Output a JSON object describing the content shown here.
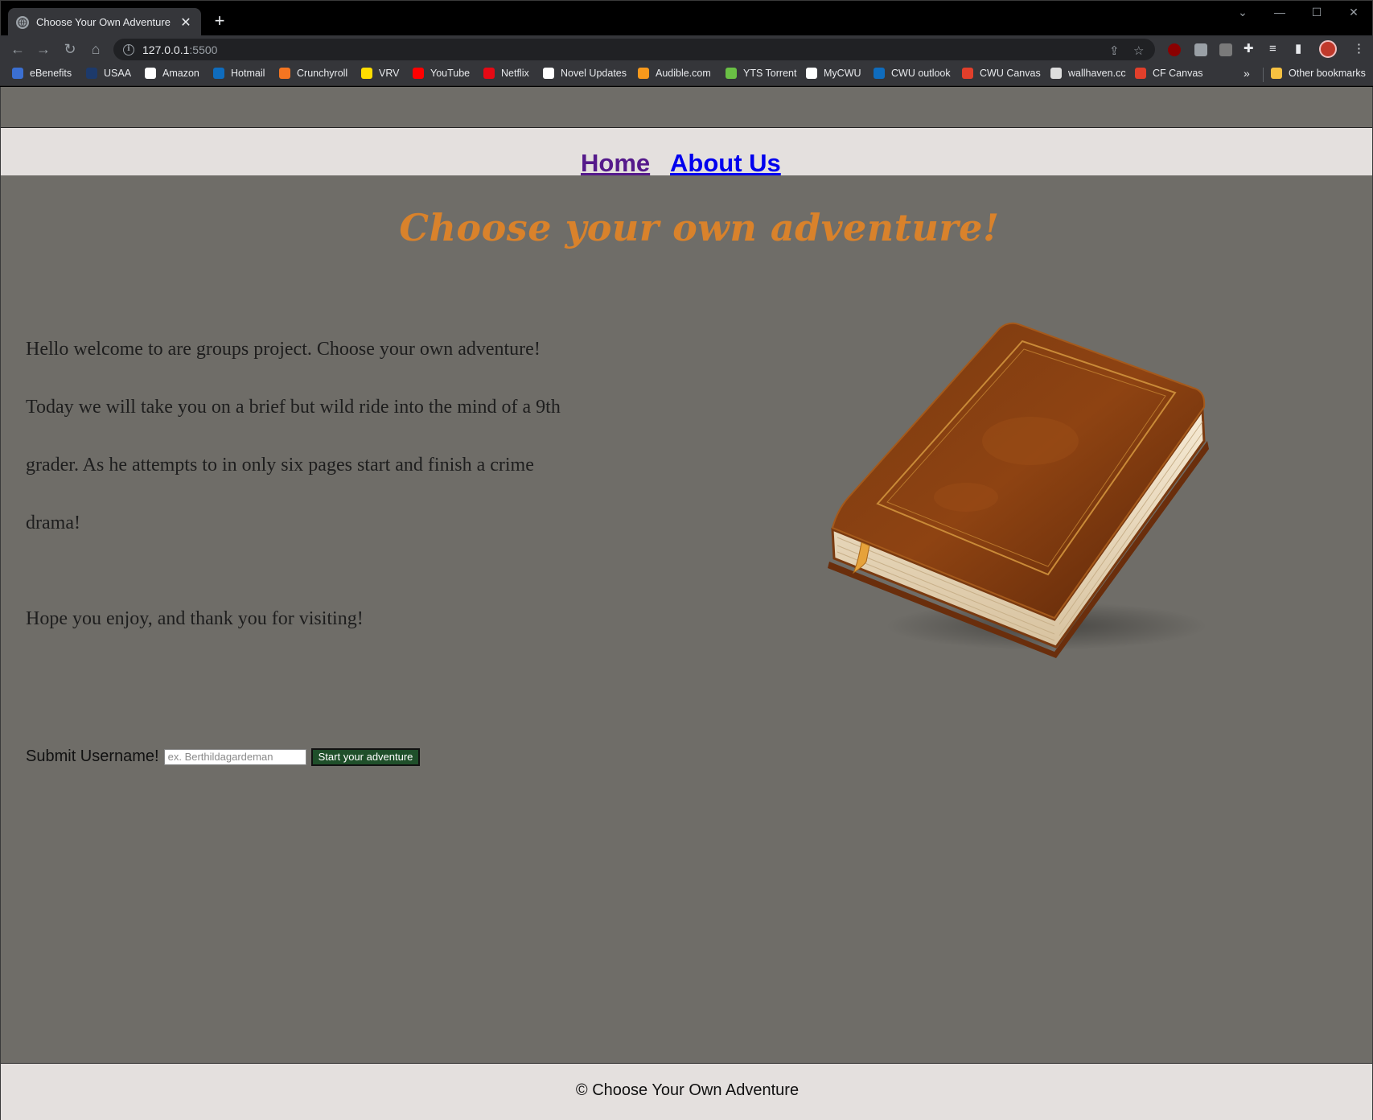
{
  "browser": {
    "tab_title": "Choose Your Own Adventure",
    "tab_close": "✕",
    "new_tab": "+",
    "url_host": "127.0.0.1",
    "url_port": ":5500",
    "bookmarks": [
      {
        "label": "eBenefits",
        "icon_color": "#3b6fd1"
      },
      {
        "label": "USAA",
        "icon_color": "#1d3a6b"
      },
      {
        "label": "Amazon",
        "icon_color": "#ffffff"
      },
      {
        "label": "Hotmail",
        "icon_color": "#0f6cbd"
      },
      {
        "label": "Crunchyroll",
        "icon_color": "#f47521"
      },
      {
        "label": "VRV",
        "icon_color": "#ffdd00"
      },
      {
        "label": "YouTube",
        "icon_color": "#ff0000"
      },
      {
        "label": "Netflix",
        "icon_color": "#e50914"
      },
      {
        "label": "Novel Updates",
        "icon_color": "#ffffff"
      },
      {
        "label": "Audible.com",
        "icon_color": "#f7991c"
      },
      {
        "label": "YTS Torrent",
        "icon_color": "#6ac045"
      },
      {
        "label": "MyCWU",
        "icon_color": "#ffffff"
      },
      {
        "label": "CWU outlook",
        "icon_color": "#0f6cbd"
      },
      {
        "label": "CWU Canvas",
        "icon_color": "#e13f2b"
      },
      {
        "label": "wallhaven.cc",
        "icon_color": "#dddddd"
      },
      {
        "label": "CF Canvas",
        "icon_color": "#e13f2b"
      }
    ],
    "bookmarks_more": "»",
    "other_bookmarks": "Other bookmarks"
  },
  "site": {
    "nav": {
      "home": "Home",
      "about": "About Us"
    },
    "title": "Choose your own adventure!",
    "intro": "Hello welcome to are groups project. Choose your own adventure! Today we will take you on a brief but wild ride into the mind of a 9th grader. As he attempts to in only six pages start and finish a crime drama!",
    "closing": "Hope you enjoy, and thank you for visiting!",
    "form": {
      "label": "Submit Username!",
      "placeholder": "ex. Berthildagardeman",
      "button": "Start your adventure"
    },
    "footer": "© Choose Your Own Adventure"
  },
  "colors": {
    "page_bg": "#6f6d68",
    "nav_bg": "#e4e0de",
    "title": "#d9822b",
    "visited_link": "#551a8b",
    "link": "#0000ee",
    "button_bg": "#1f4f2a"
  }
}
